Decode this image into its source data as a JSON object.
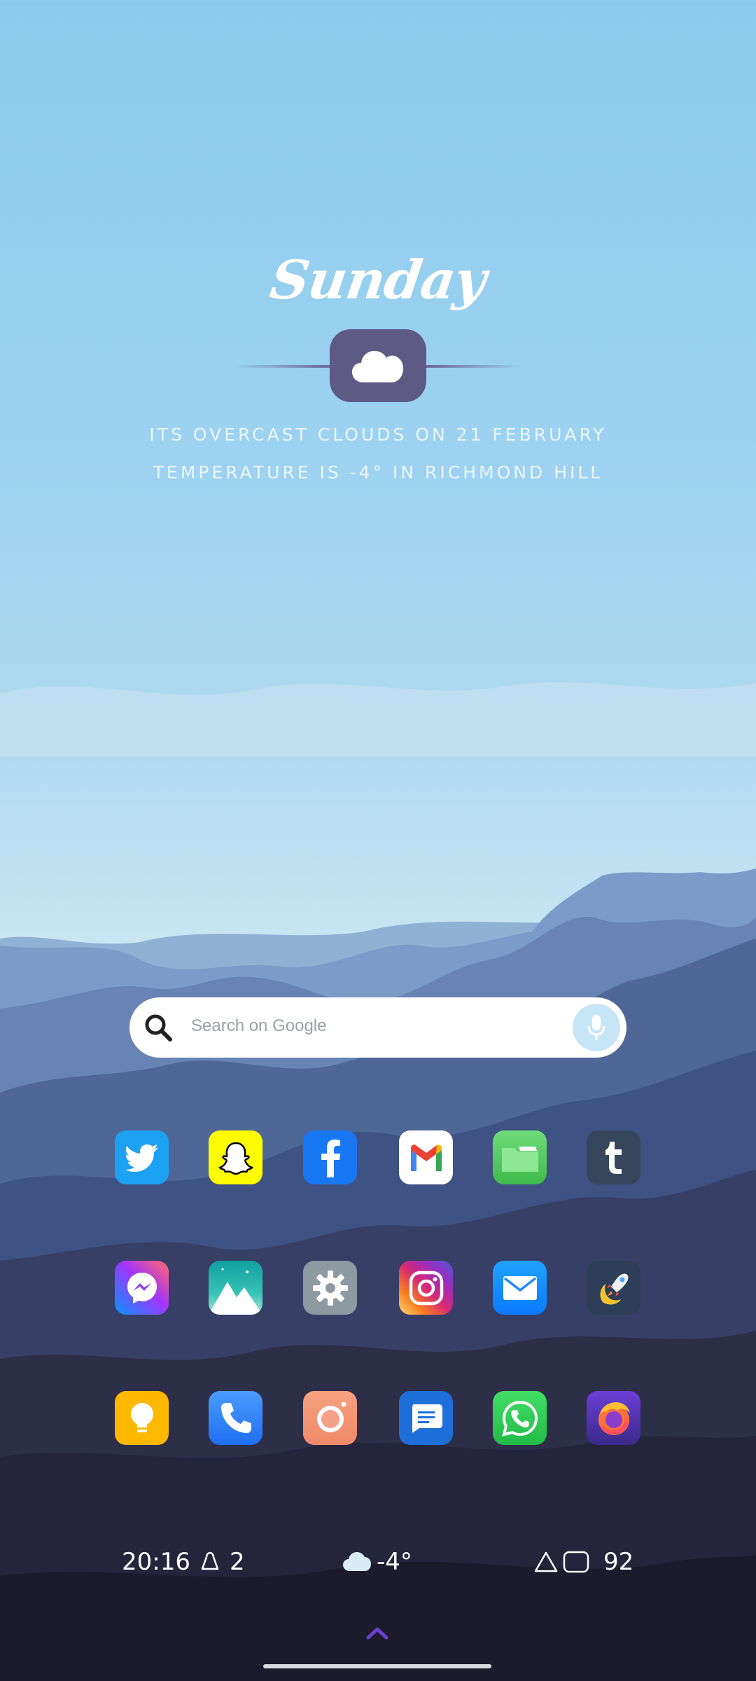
{
  "widget": {
    "day": "Sunday",
    "weather_icon": "cloud-icon",
    "line1": "ITS OVERCAST CLOUDS ON 21 FEBRUARY",
    "line2": "TEMPERATURE IS -4° IN RICHMOND HILL"
  },
  "search": {
    "placeholder": "Search on Google",
    "icons": [
      "search-icon",
      "mic-icon"
    ]
  },
  "apps": {
    "row1": [
      "Twitter",
      "Snapchat",
      "Facebook",
      "Gmail",
      "Files",
      "Tumblr"
    ],
    "row2": [
      "Messenger",
      "Gallery",
      "Settings",
      "Instagram",
      "Email",
      "Launcher"
    ],
    "row3": [
      "Tips",
      "Phone",
      "Camera",
      "Messages",
      "WhatsApp",
      "Firefox"
    ]
  },
  "status": {
    "time": "20:16",
    "notification_count": "2",
    "weather_temp": "-4°",
    "battery": "92"
  },
  "colors": {
    "sky_top": "#8ccbee",
    "badge": "#5d5a86",
    "accent_chevron": "#6a3fd0"
  }
}
